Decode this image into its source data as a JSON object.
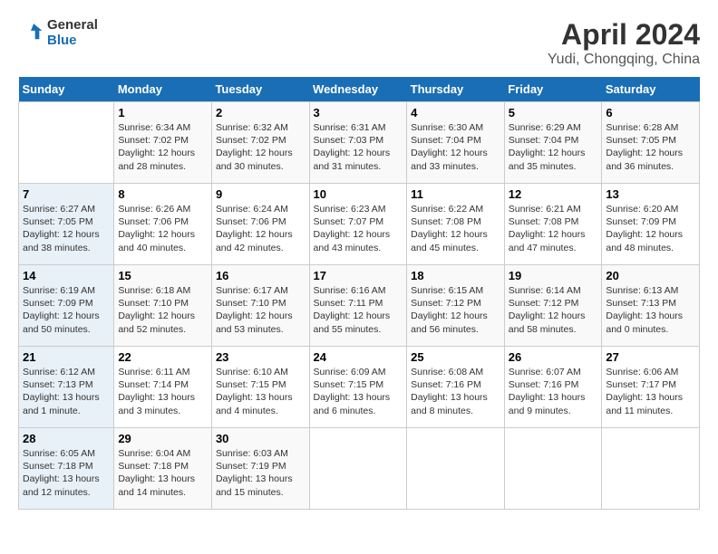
{
  "header": {
    "logo_line1": "General",
    "logo_line2": "Blue",
    "title": "April 2024",
    "subtitle": "Yudi, Chongqing, China"
  },
  "weekdays": [
    "Sunday",
    "Monday",
    "Tuesday",
    "Wednesday",
    "Thursday",
    "Friday",
    "Saturday"
  ],
  "weeks": [
    [
      {
        "day": "",
        "info": ""
      },
      {
        "day": "1",
        "info": "Sunrise: 6:34 AM\nSunset: 7:02 PM\nDaylight: 12 hours\nand 28 minutes."
      },
      {
        "day": "2",
        "info": "Sunrise: 6:32 AM\nSunset: 7:02 PM\nDaylight: 12 hours\nand 30 minutes."
      },
      {
        "day": "3",
        "info": "Sunrise: 6:31 AM\nSunset: 7:03 PM\nDaylight: 12 hours\nand 31 minutes."
      },
      {
        "day": "4",
        "info": "Sunrise: 6:30 AM\nSunset: 7:04 PM\nDaylight: 12 hours\nand 33 minutes."
      },
      {
        "day": "5",
        "info": "Sunrise: 6:29 AM\nSunset: 7:04 PM\nDaylight: 12 hours\nand 35 minutes."
      },
      {
        "day": "6",
        "info": "Sunrise: 6:28 AM\nSunset: 7:05 PM\nDaylight: 12 hours\nand 36 minutes."
      }
    ],
    [
      {
        "day": "7",
        "info": "Sunrise: 6:27 AM\nSunset: 7:05 PM\nDaylight: 12 hours\nand 38 minutes."
      },
      {
        "day": "8",
        "info": "Sunrise: 6:26 AM\nSunset: 7:06 PM\nDaylight: 12 hours\nand 40 minutes."
      },
      {
        "day": "9",
        "info": "Sunrise: 6:24 AM\nSunset: 7:06 PM\nDaylight: 12 hours\nand 42 minutes."
      },
      {
        "day": "10",
        "info": "Sunrise: 6:23 AM\nSunset: 7:07 PM\nDaylight: 12 hours\nand 43 minutes."
      },
      {
        "day": "11",
        "info": "Sunrise: 6:22 AM\nSunset: 7:08 PM\nDaylight: 12 hours\nand 45 minutes."
      },
      {
        "day": "12",
        "info": "Sunrise: 6:21 AM\nSunset: 7:08 PM\nDaylight: 12 hours\nand 47 minutes."
      },
      {
        "day": "13",
        "info": "Sunrise: 6:20 AM\nSunset: 7:09 PM\nDaylight: 12 hours\nand 48 minutes."
      }
    ],
    [
      {
        "day": "14",
        "info": "Sunrise: 6:19 AM\nSunset: 7:09 PM\nDaylight: 12 hours\nand 50 minutes."
      },
      {
        "day": "15",
        "info": "Sunrise: 6:18 AM\nSunset: 7:10 PM\nDaylight: 12 hours\nand 52 minutes."
      },
      {
        "day": "16",
        "info": "Sunrise: 6:17 AM\nSunset: 7:10 PM\nDaylight: 12 hours\nand 53 minutes."
      },
      {
        "day": "17",
        "info": "Sunrise: 6:16 AM\nSunset: 7:11 PM\nDaylight: 12 hours\nand 55 minutes."
      },
      {
        "day": "18",
        "info": "Sunrise: 6:15 AM\nSunset: 7:12 PM\nDaylight: 12 hours\nand 56 minutes."
      },
      {
        "day": "19",
        "info": "Sunrise: 6:14 AM\nSunset: 7:12 PM\nDaylight: 12 hours\nand 58 minutes."
      },
      {
        "day": "20",
        "info": "Sunrise: 6:13 AM\nSunset: 7:13 PM\nDaylight: 13 hours\nand 0 minutes."
      }
    ],
    [
      {
        "day": "21",
        "info": "Sunrise: 6:12 AM\nSunset: 7:13 PM\nDaylight: 13 hours\nand 1 minute."
      },
      {
        "day": "22",
        "info": "Sunrise: 6:11 AM\nSunset: 7:14 PM\nDaylight: 13 hours\nand 3 minutes."
      },
      {
        "day": "23",
        "info": "Sunrise: 6:10 AM\nSunset: 7:15 PM\nDaylight: 13 hours\nand 4 minutes."
      },
      {
        "day": "24",
        "info": "Sunrise: 6:09 AM\nSunset: 7:15 PM\nDaylight: 13 hours\nand 6 minutes."
      },
      {
        "day": "25",
        "info": "Sunrise: 6:08 AM\nSunset: 7:16 PM\nDaylight: 13 hours\nand 8 minutes."
      },
      {
        "day": "26",
        "info": "Sunrise: 6:07 AM\nSunset: 7:16 PM\nDaylight: 13 hours\nand 9 minutes."
      },
      {
        "day": "27",
        "info": "Sunrise: 6:06 AM\nSunset: 7:17 PM\nDaylight: 13 hours\nand 11 minutes."
      }
    ],
    [
      {
        "day": "28",
        "info": "Sunrise: 6:05 AM\nSunset: 7:18 PM\nDaylight: 13 hours\nand 12 minutes."
      },
      {
        "day": "29",
        "info": "Sunrise: 6:04 AM\nSunset: 7:18 PM\nDaylight: 13 hours\nand 14 minutes."
      },
      {
        "day": "30",
        "info": "Sunrise: 6:03 AM\nSunset: 7:19 PM\nDaylight: 13 hours\nand 15 minutes."
      },
      {
        "day": "",
        "info": ""
      },
      {
        "day": "",
        "info": ""
      },
      {
        "day": "",
        "info": ""
      },
      {
        "day": "",
        "info": ""
      }
    ]
  ]
}
